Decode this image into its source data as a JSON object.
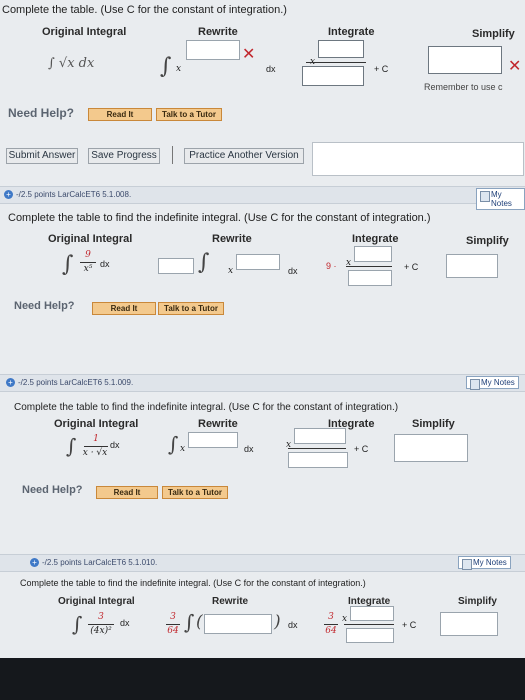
{
  "section1": {
    "instruction": "Complete the table. (Use C for the constant of integration.)",
    "headers": {
      "original": "Original Integral",
      "rewrite": "Rewrite",
      "integrate": "Integrate",
      "simplify": "Simplify"
    },
    "original_expr": "∫ √x dx",
    "dx": "dx",
    "x": "x",
    "plus_c": "+ C",
    "remember": "Remember to use c",
    "need_help": "Need Help?",
    "read_it": "Read It",
    "talk_tutor": "Talk to a Tutor",
    "submit": "Submit Answer",
    "save": "Save Progress",
    "practice": "Practice Another Version"
  },
  "section2": {
    "points": "-/2.5 points  LarCalcET6 5.1.008.",
    "my_notes": "My Notes",
    "instruction": "Complete the table to find the indefinite integral. (Use C for the constant of integration.)",
    "headers": {
      "original": "Original Integral",
      "rewrite": "Rewrite",
      "integrate": "Integrate",
      "simplify": "Simplify"
    },
    "num": "9",
    "den": "x⁵",
    "dx": "dx",
    "x": "x",
    "nine_dot": "9 ·",
    "plus_c": "+ C",
    "need_help": "Need Help?",
    "read_it": "Read It",
    "talk_tutor": "Talk to a Tutor"
  },
  "section3": {
    "points": "-/2.5 points  LarCalcET6 5.1.009.",
    "my_notes": "My Notes",
    "instruction": "Complete the table to find the indefinite integral. (Use C for the constant of integration.)",
    "headers": {
      "original": "Original Integral",
      "rewrite": "Rewrite",
      "integrate": "Integrate",
      "simplify": "Simplify"
    },
    "num": "1",
    "den": "x · √x",
    "dx": "dx",
    "x": "x",
    "plus_c": "+ C",
    "need_help": "Need Help?",
    "read_it": "Read It",
    "talk_tutor": "Talk to a Tutor"
  },
  "section4": {
    "points": "-/2.5 points  LarCalcET6 5.1.010.",
    "my_notes": "My Notes",
    "instruction": "Complete the table to find the indefinite integral. (Use C for the constant of integration.)",
    "headers": {
      "original": "Original Integral",
      "rewrite": "Rewrite",
      "integrate": "Integrate",
      "simplify": "Simplify"
    },
    "num": "3",
    "den": "(4x)²",
    "coef_num": "3",
    "coef_den": "64",
    "dx": "dx",
    "x": "x",
    "plus_c": "+ C"
  }
}
